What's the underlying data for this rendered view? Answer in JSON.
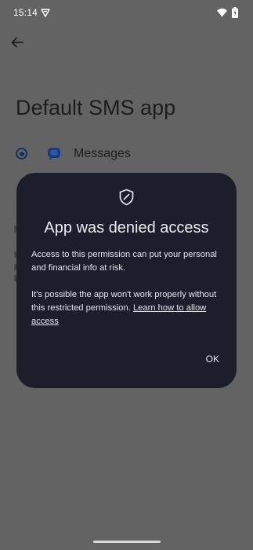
{
  "status_bar": {
    "time": "15:14",
    "icons": [
      "vpn-icon",
      "wifi-icon",
      "battery-icon"
    ]
  },
  "page": {
    "back_icon": "arrow-back-icon",
    "title": "Default SMS app",
    "option": {
      "label": "Messages",
      "icon": "messages-icon",
      "selected": true
    }
  },
  "dialog": {
    "icon": "shield-icon",
    "title": "App was denied access",
    "paragraph1": "Access to this permission can put your personal and financial info at risk.",
    "paragraph2_prefix": "It's possible the app won't work properly without this restricted permission. ",
    "learn_link": "Learn how to allow access",
    "ok_label": "OK"
  },
  "colors": {
    "scrim": "#636363",
    "dialog_bg": "#1d1e2b",
    "accent": "#16305c"
  }
}
